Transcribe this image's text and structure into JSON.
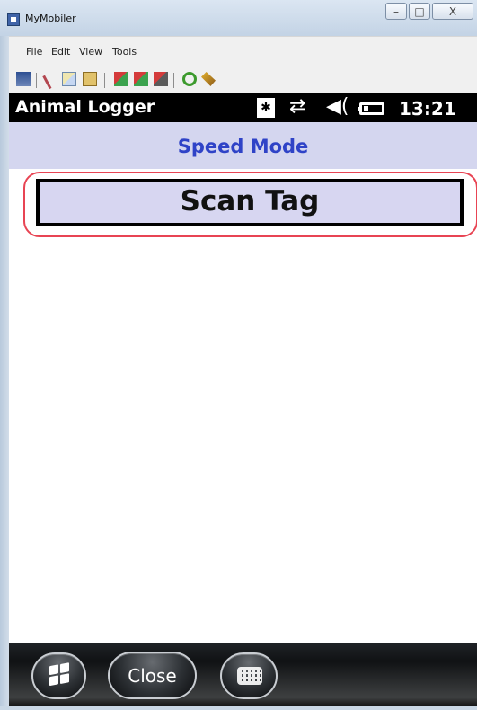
{
  "window": {
    "title": "MyMobiler",
    "menu": [
      "File",
      "Edit",
      "View",
      "Tools"
    ],
    "caption_buttons": {
      "minimize": "–",
      "maximize": "□",
      "close": "X"
    }
  },
  "device": {
    "title": "Animal Logger",
    "time": "13:21",
    "bluetooth": "✱",
    "sync": "⇄",
    "speaker": "◀("
  },
  "app": {
    "mode": "Speed Mode",
    "scan_button": "Scan Tag"
  },
  "taskbar": {
    "close_label": "Close"
  },
  "colors": {
    "mode_bg": "#d4d6ef",
    "mode_text": "#2f43c7",
    "highlight": "#e84453"
  }
}
